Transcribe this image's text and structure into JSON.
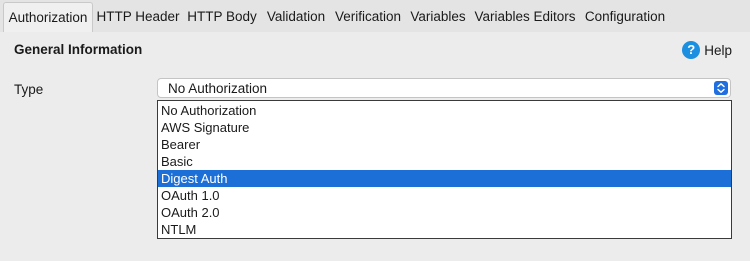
{
  "tabs": [
    "Authorization",
    "HTTP Header",
    "HTTP Body",
    "Validation",
    "Verification",
    "Variables",
    "Variables Editors",
    "Configuration"
  ],
  "active_tab": "Authorization",
  "section": {
    "title": "General Information",
    "help_label": "Help",
    "help_icon": "question-circle-icon"
  },
  "type_field": {
    "label": "Type",
    "value": "No Authorization",
    "options": [
      "No Authorization",
      "AWS Signature",
      "Bearer",
      "Basic",
      "Digest Auth",
      "OAuth 1.0",
      "OAuth 2.0",
      "NTLM"
    ],
    "highlighted": "Digest Auth"
  },
  "colors": {
    "selection": "#1d6fd8",
    "help_icon": "#1b8fe0",
    "select_arrow": "#1f6fe0"
  }
}
